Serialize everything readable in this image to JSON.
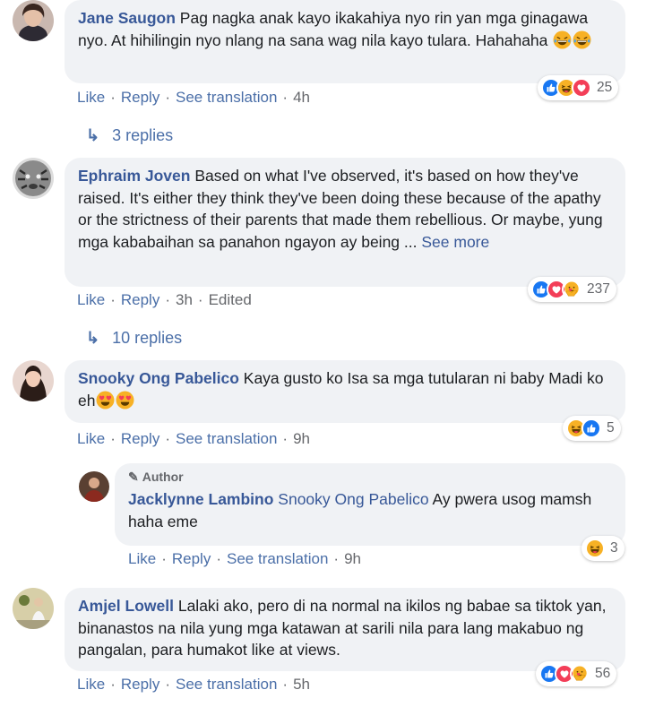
{
  "actions": {
    "like": "Like",
    "reply": "Reply",
    "see_translation": "See translation",
    "edited": "Edited"
  },
  "comments": [
    {
      "author": "Jane Saugon",
      "text": "Pag nagka anak kayo ikakahiya nyo rin yan mga ginagawa nyo. At hihilingin nyo nlang na sana wag nila kayo tularа. Hahahaha",
      "time": "4h",
      "reaction_count": "25",
      "replies": "3 replies"
    },
    {
      "author": "Ephraim Joven",
      "text": "Based on what I've observed, it's based on how they've raised. It's either they think they've been doing these because of the apathy or the strictness of their parents that made them rebellious. Or maybe, yung mga kababaihan sa panahon ngayon ay being ...",
      "see_more": "See more",
      "time": "3h",
      "reaction_count": "237",
      "replies": "10 replies"
    },
    {
      "author": "Snooky Ong Pabelico",
      "text": "Kaya gusto ko Isa sa mga tutularan ni baby Madi ko eh",
      "time": "9h",
      "reaction_count": "5"
    },
    {
      "badge": "Author",
      "author": "Jacklynne Lambino",
      "mention": "Snooky Ong Pabelico",
      "text": "Ay pwera usog mamsh haha eme",
      "time": "9h",
      "reaction_count": "3"
    },
    {
      "author": "Amjel Lowell",
      "text": "Lalaki ako, pero di na normal na ikilos ng babae sa tiktok yan, binanastos na nila yung mga katawan at sarili nila para lang makabuo ng pangalan, para humakot like at views.",
      "time": "5h",
      "reaction_count": "56"
    }
  ],
  "colors": {
    "link": "#385898",
    "bubble": "#f0f2f5",
    "meta": "#65676b",
    "like_blue": "#1877f2",
    "love_red": "#f33e58",
    "haha_yellow": "#f7b125"
  }
}
